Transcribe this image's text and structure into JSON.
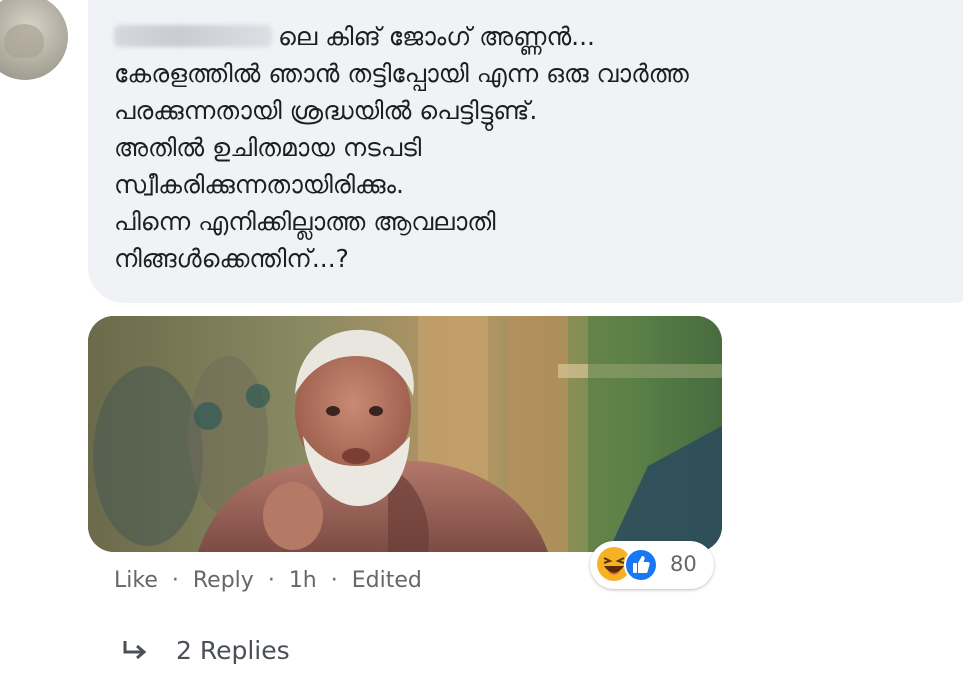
{
  "comment": {
    "lines": [
      "ലെ കിങ് ജോംഗ് അണ്ണൻ...",
      "കേരളത്തിൽ ഞാൻ തട്ടിപ്പോയി എന്ന ഒരു വാർത്ത",
      "പരക്കുന്നതായി ശ്രദ്ധയിൽ പെട്ടിട്ടുണ്ട്.",
      "അതിൽ ഉചിതമായ നടപടി",
      "സ്വീകരിക്കുന്നതായിരിക്കും.",
      "പിന്നെ എനിക്കില്ലാത്ത ആവലാതി",
      "നിങ്ങൾക്കെന്തിന്...?"
    ]
  },
  "reactions": {
    "icons": [
      "haha-icon",
      "like-icon"
    ],
    "count": "80"
  },
  "actions": {
    "like_label": "Like",
    "reply_label": "Reply",
    "separator": "·",
    "time": "1h",
    "edited_label": "Edited"
  },
  "replies": {
    "icon": "reply-arrow-icon",
    "label": "2 Replies"
  },
  "colors": {
    "bubble": "#f0f2f5",
    "meta_text": "#65676b",
    "like_blue": "#1877f2",
    "haha_yellow": "#f7b125"
  }
}
